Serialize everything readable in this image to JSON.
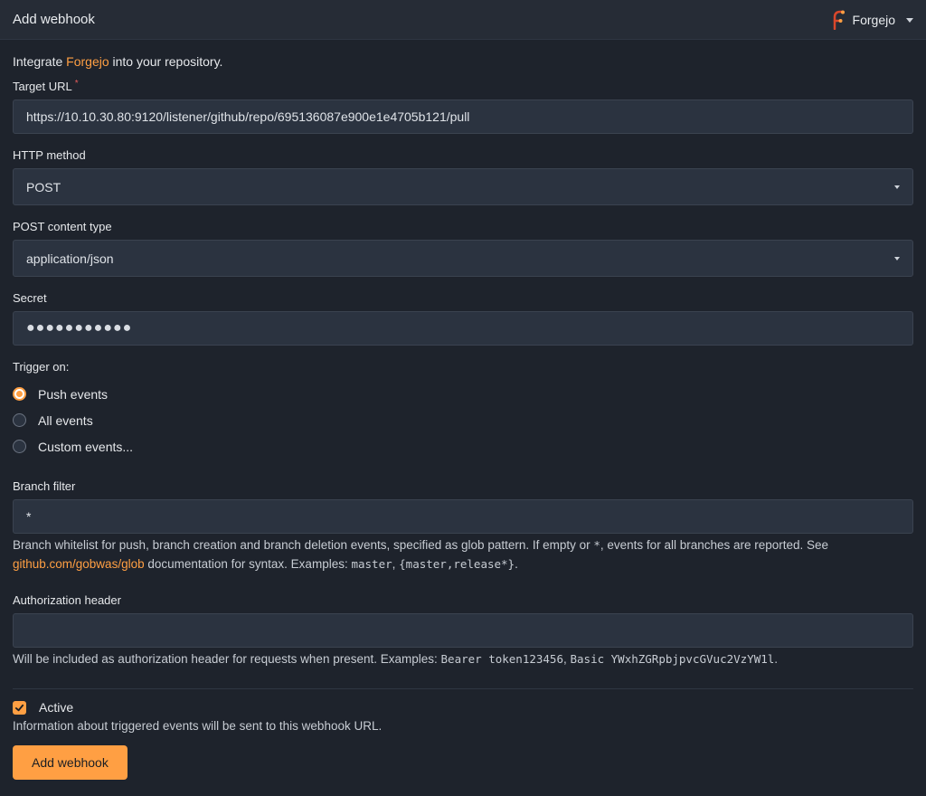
{
  "header": {
    "title": "Add webhook",
    "brand_name": "Forgejo"
  },
  "intro": {
    "before": "Integrate ",
    "link": "Forgejo",
    "after": " into your repository."
  },
  "target_url": {
    "label": "Target URL",
    "required_mark": "*",
    "value": "https://10.10.30.80:9120/listener/github/repo/695136087e900e1e4705b121/pull"
  },
  "http_method": {
    "label": "HTTP method",
    "selected": "POST"
  },
  "content_type": {
    "label": "POST content type",
    "selected": "application/json"
  },
  "secret": {
    "label": "Secret",
    "masked": "●●●●●●●●●●●"
  },
  "trigger": {
    "label": "Trigger on:",
    "options": [
      {
        "label": "Push events",
        "checked": true
      },
      {
        "label": "All events",
        "checked": false
      },
      {
        "label": "Custom events...",
        "checked": false
      }
    ]
  },
  "branch_filter": {
    "label": "Branch filter",
    "value": "*",
    "help": {
      "p1": "Branch whitelist for push, branch creation and branch deletion events, specified as glob pattern. If empty or ",
      "code1": "*",
      "p2": ", events for all branches are reported. See ",
      "link": "github.com/gobwas/glob",
      "p3": " documentation for syntax. Examples: ",
      "code2": "master",
      "sep": ", ",
      "code3": "{master,release*}",
      "end": "."
    }
  },
  "auth_header": {
    "label": "Authorization header",
    "value": "",
    "help": {
      "p1": "Will be included as authorization header for requests when present. Examples: ",
      "code1": "Bearer token123456",
      "sep": ", ",
      "code2": "Basic YWxhZGRpbjpvcGVuc2VzYW1l",
      "end": "."
    }
  },
  "active": {
    "label": "Active",
    "checked": true,
    "help": "Information about triggered events will be sent to this webhook URL."
  },
  "submit": {
    "label": "Add webhook"
  },
  "colors": {
    "accent": "#ff9f43",
    "background": "#1e232c",
    "input": "#2b3340"
  }
}
